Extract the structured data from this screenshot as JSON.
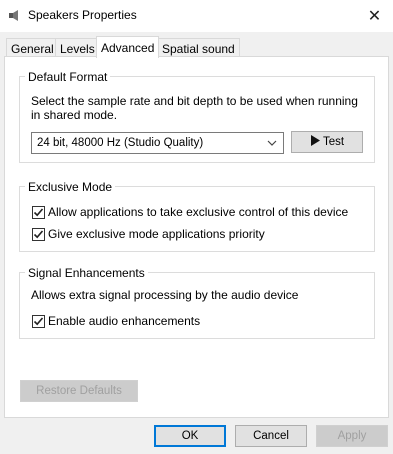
{
  "window": {
    "title": "Speakers Properties",
    "close_glyph": "✕"
  },
  "tabs": [
    {
      "label": "General",
      "active": false
    },
    {
      "label": "Levels",
      "active": false
    },
    {
      "label": "Advanced",
      "active": true
    },
    {
      "label": "Spatial sound",
      "active": false
    }
  ],
  "default_format": {
    "title": "Default Format",
    "description_line1": "Select the sample rate and bit depth to be used when running",
    "description_line2": "in shared mode.",
    "selected_format": "24 bit, 48000 Hz (Studio Quality)",
    "test_label": "Test"
  },
  "exclusive_mode": {
    "title": "Exclusive Mode",
    "option1": {
      "label": "Allow applications to take exclusive control of this device",
      "checked": true
    },
    "option2": {
      "label": "Give exclusive mode applications priority",
      "checked": true
    }
  },
  "signal_enhancements": {
    "title": "Signal Enhancements",
    "description": "Allows extra signal processing by the audio device",
    "option": {
      "label": "Enable audio enhancements",
      "checked": true
    }
  },
  "restore_defaults_label": "Restore Defaults",
  "footer": {
    "ok_label": "OK",
    "cancel_label": "Cancel",
    "apply_label": "Apply"
  },
  "colors": {
    "focus_blue": "#0078d7",
    "disabled_text": "#a0a0a0"
  },
  "icons": {
    "title": "speaker-icon",
    "close": "close-icon",
    "dropdown": "chevron-down-icon",
    "test": "play-icon",
    "check": "checkmark-icon"
  }
}
